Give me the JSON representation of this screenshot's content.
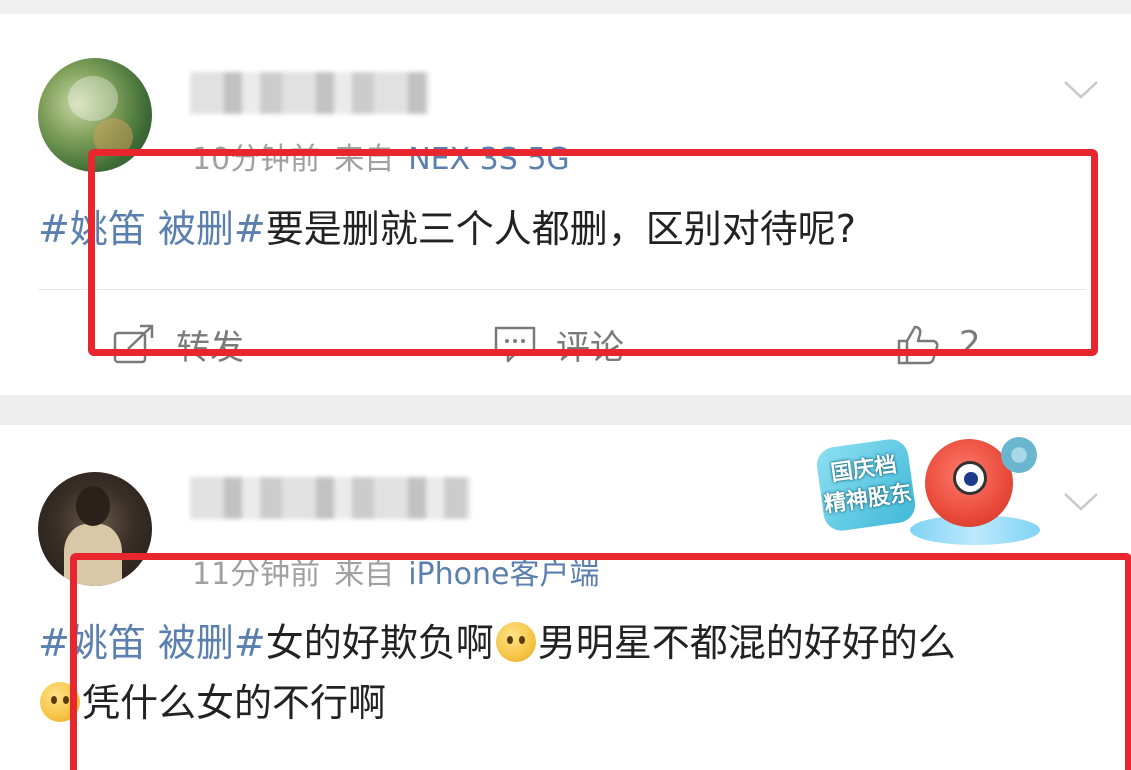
{
  "colors": {
    "hashtag": "#5b7fae",
    "device": "#5b7fae",
    "meta": "#a0a0a0",
    "action": "#7a7a7a",
    "highlight": "#e8262d",
    "separator": "#eeeeee"
  },
  "posts": [
    {
      "time": "10分钟前",
      "from_label": "来自",
      "device": "NEX 3S 5G",
      "hashtag": "#姚笛 被删#",
      "text": "要是删就三个人都删，区别对待呢?",
      "actions": {
        "repost_label": "转发",
        "comment_label": "评论",
        "like_count": "2"
      }
    },
    {
      "time": "11分钟前",
      "from_label": "来自",
      "device": "iPhone客户端",
      "hashtag": "#姚笛 被删#",
      "text_part1": "女的好欺负啊",
      "text_part2": "男明星不都混的好好的么",
      "text_part3": "凭什么女的不行啊",
      "emojis": [
        "doubt-emoji",
        "cry-emoji"
      ],
      "promo": {
        "line1": "国庆档",
        "line2": "精神股东"
      }
    }
  ],
  "icons": [
    "chevron-down-icon",
    "repost-icon",
    "comment-icon",
    "like-icon"
  ]
}
